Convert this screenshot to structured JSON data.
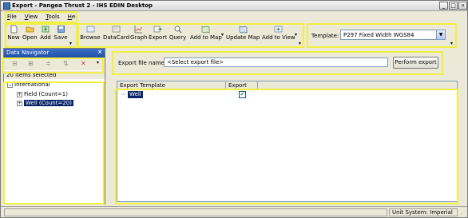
{
  "window": {
    "title": "Export - Pangea Thrust 2 - IHS EDIN Desktop",
    "controls": [
      "_",
      "□",
      "×"
    ]
  },
  "menubar": {
    "items": [
      "File",
      "View",
      "Tools",
      "Hel"
    ]
  },
  "toolbar": {
    "group1": [
      {
        "label": "New",
        "icon": "new-document-icon"
      },
      {
        "label": "Open",
        "icon": "folder-open-icon"
      },
      {
        "label": "Add",
        "icon": "add-icon"
      },
      {
        "label": "Save",
        "icon": "save-icon"
      }
    ],
    "group2": [
      {
        "label": "Browse",
        "icon": "browse-icon"
      },
      {
        "label": "DataCard",
        "icon": "datacard-icon"
      },
      {
        "label": "Graph",
        "icon": "graph-icon"
      },
      {
        "label": "Export",
        "icon": "export-icon"
      },
      {
        "label": "Query",
        "icon": "query-icon"
      },
      {
        "label": "Add to Map",
        "icon": "map-add-icon"
      },
      {
        "label": "Update Map",
        "icon": "map-update-icon"
      },
      {
        "label": "Add to View",
        "icon": "view-add-icon"
      }
    ],
    "template_label": "Template:",
    "template_value": "P297 Fixed Width WGS84"
  },
  "navigator": {
    "title": "Data Navigator",
    "status": "20 items selected",
    "tree": [
      {
        "label": "International",
        "level": 0,
        "selected": false
      },
      {
        "label": "Field (Count=1)",
        "level": 1,
        "selected": false
      },
      {
        "label": "Well (Count=20)",
        "level": 1,
        "selected": true
      }
    ]
  },
  "export": {
    "file_label": "Export file name:",
    "file_placeholder": "<Select export file>",
    "perform_button": "Perform export",
    "columns": [
      "Export Template",
      "Export"
    ],
    "rows": [
      {
        "template": "Well",
        "checked": true
      }
    ]
  },
  "statusbar": {
    "units": "Unit System: Imperial"
  },
  "colors": {
    "highlight": "#f0f040",
    "selection": "#0a246a",
    "panel_header": "#1f4ea8"
  }
}
